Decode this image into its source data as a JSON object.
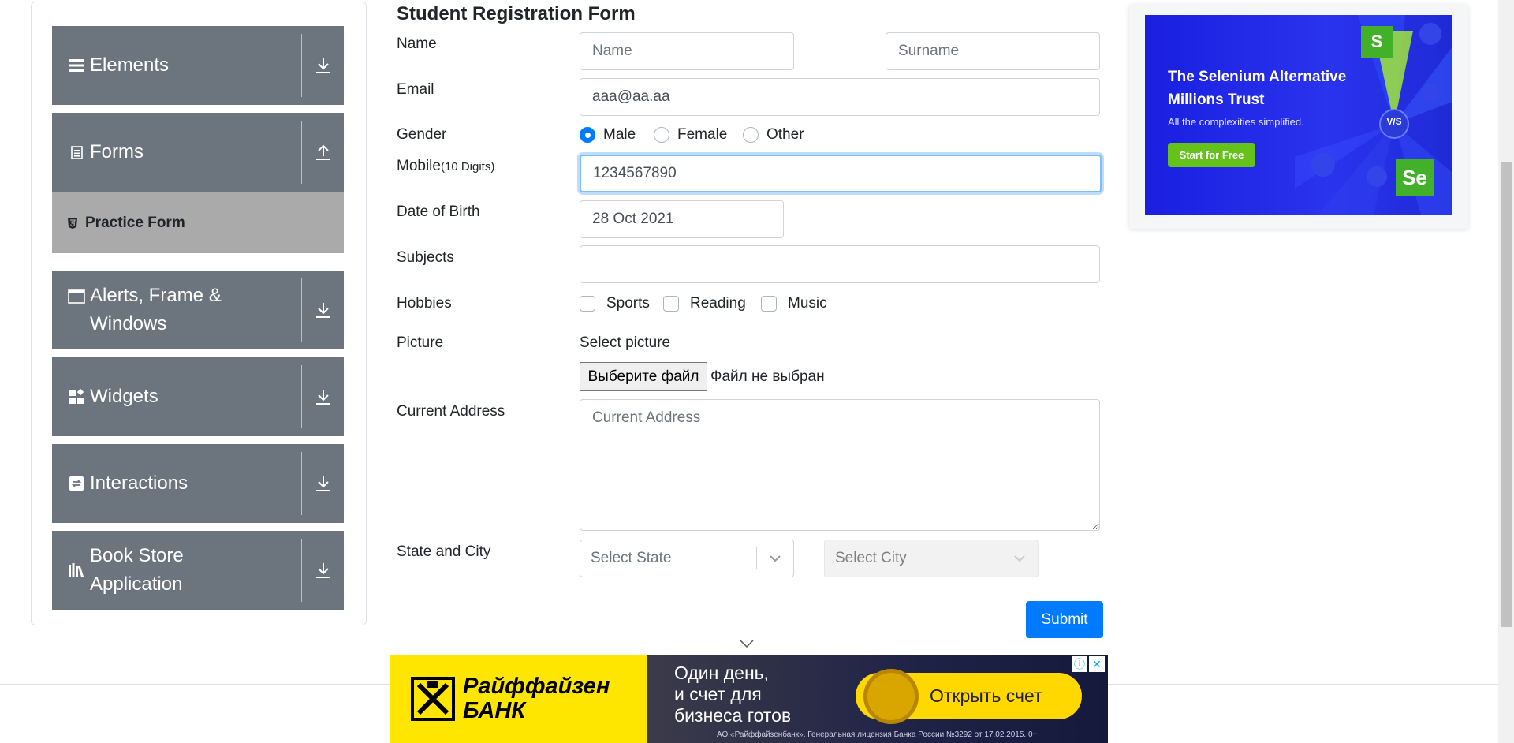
{
  "sidebar": {
    "groups": [
      {
        "label": "Elements",
        "icon": "hamburger-icon",
        "arrow": "download-arrow-icon"
      },
      {
        "label": "Forms",
        "icon": "document-icon",
        "arrow": "upload-arrow-icon",
        "sub_items": [
          {
            "label": "Practice Form",
            "icon": "html5-icon"
          }
        ]
      },
      {
        "label": "Alerts, Frame & Windows",
        "icon": "window-icon",
        "arrow": "download-arrow-icon"
      },
      {
        "label": "Widgets",
        "icon": "widgets-icon",
        "arrow": "download-arrow-icon"
      },
      {
        "label": "Interactions",
        "icon": "interactions-icon",
        "arrow": "download-arrow-icon"
      },
      {
        "label": "Book Store Application",
        "icon": "books-icon",
        "arrow": "download-arrow-icon"
      }
    ],
    "colors": {
      "group_bg": "#6c757d",
      "active_bg": "#aaaaaa"
    }
  },
  "form": {
    "title": "Student Registration Form",
    "name": {
      "label": "Name",
      "first_placeholder": "Name",
      "last_placeholder": "Surname",
      "first_value": "",
      "last_value": ""
    },
    "email": {
      "label": "Email",
      "value": "aaa@aa.aa"
    },
    "gender": {
      "label": "Gender",
      "options": [
        "Male",
        "Female",
        "Other"
      ],
      "selected": "Male"
    },
    "mobile": {
      "label": "Mobile",
      "hint": "(10 Digits)",
      "value": "1234567890"
    },
    "dob": {
      "label": "Date of Birth",
      "value": "28 Oct 2021"
    },
    "subjects": {
      "label": "Subjects",
      "value": ""
    },
    "hobbies": {
      "label": "Hobbies",
      "options": [
        "Sports",
        "Reading",
        "Music"
      ]
    },
    "picture": {
      "label": "Picture",
      "select_label": "Select picture",
      "button": "Выберите файл",
      "status": "Файл не выбран"
    },
    "address": {
      "label": "Current Address",
      "placeholder": "Current Address"
    },
    "state_city": {
      "label": "State and City",
      "state_placeholder": "Select State",
      "city_placeholder": "Select City"
    },
    "submit": "Submit",
    "accent": "#007bff"
  },
  "right_ad": {
    "headline_1": "The Selenium Alternative",
    "headline_2": "Millions Trust",
    "subtext": "All the complexities simplified.",
    "cta": "Start for Free",
    "badge_s": "S",
    "badge_vs": "V/S",
    "badge_se": "Se"
  },
  "bottom_banner": {
    "brand_1": "Райффайзен",
    "brand_2": "БАНК",
    "message_1": "Один день,",
    "message_2": "и счет для",
    "message_3": "бизнеса готов",
    "cta": "Открыть счет",
    "legal": "АО «Райффайзенбанк». Генеральная лицензия Банка России №3292 от 17.02.2015. 0+"
  }
}
